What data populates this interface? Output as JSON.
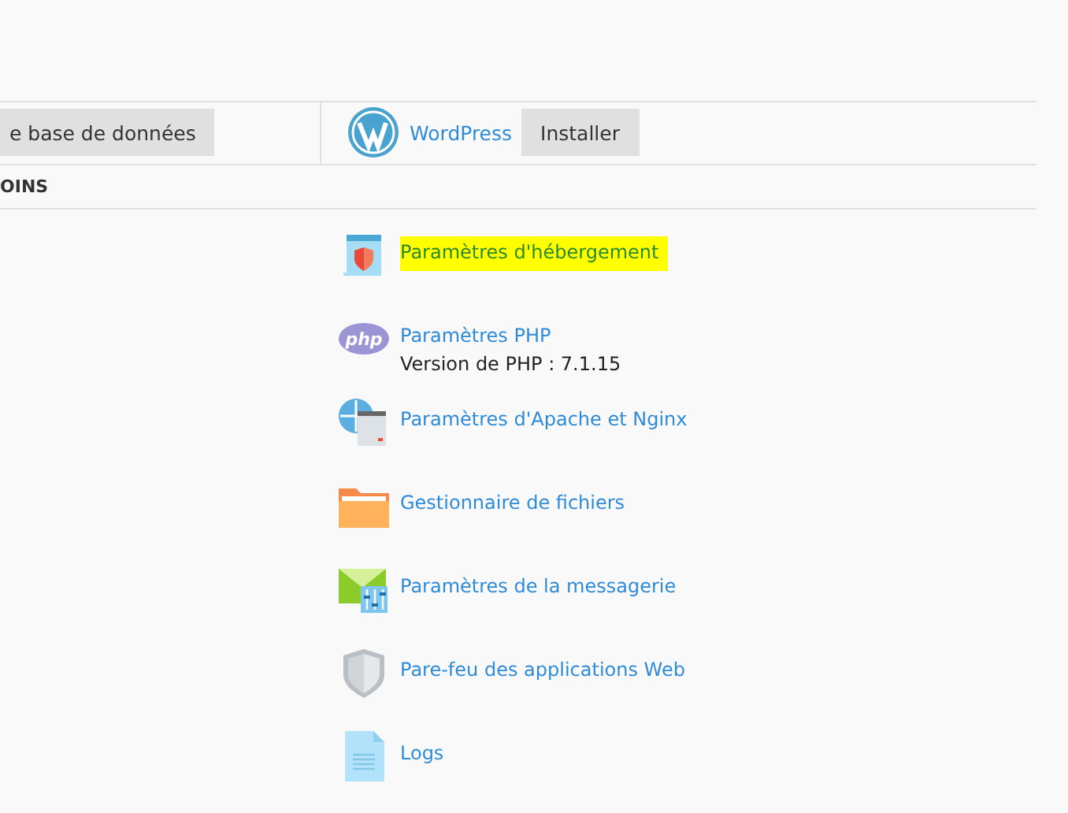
{
  "toolbar": {
    "db_button": "e base de données",
    "app_link": "WordPress",
    "install_button": "Installer"
  },
  "section_heading": "OINS",
  "tools": [
    {
      "kind": "hosting",
      "label": "Paramètres d'hébergement",
      "highlighted": true
    },
    {
      "kind": "php",
      "label": "Paramètres PHP",
      "detail": "Version de PHP : 7.1.15",
      "highlighted": false
    },
    {
      "kind": "webserver",
      "label": "Paramètres d'Apache et Nginx",
      "highlighted": false
    },
    {
      "kind": "files",
      "label": "Gestionnaire de fichiers",
      "highlighted": false
    },
    {
      "kind": "mail",
      "label": "Paramètres de la messagerie",
      "highlighted": false
    },
    {
      "kind": "firewall",
      "label": "Pare-feu des applications Web",
      "highlighted": false
    },
    {
      "kind": "logs",
      "label": "Logs",
      "highlighted": false
    }
  ]
}
